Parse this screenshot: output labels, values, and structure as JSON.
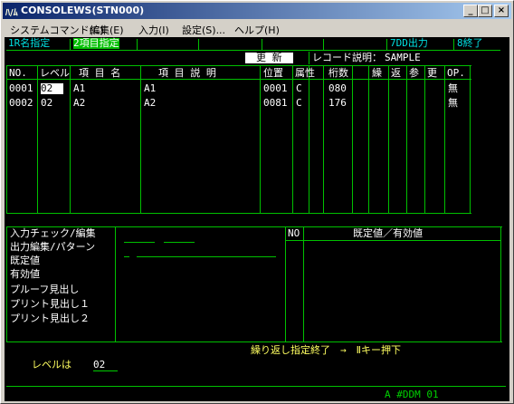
{
  "window": {
    "title": "CONSOLEWS(STN000)"
  },
  "menu": [
    "システムコマンド(C)",
    "編集(E)",
    "入力(I)",
    "設定(S)...",
    "ヘルプ(H)"
  ],
  "top": {
    "item1": "1R名指定",
    "item2": "2項目指定",
    "item7": "7DD出力",
    "item8": "8終了",
    "mode": "更 新",
    "record_label": "レコード説明：",
    "record_value": "SAMPLE"
  },
  "headers": [
    "NO.",
    "レベル",
    "項 目 名",
    "項 目 説 明",
    "位置",
    "属性",
    "桁数",
    "繰",
    "返",
    "参",
    "更",
    "OP."
  ],
  "rows": [
    {
      "no": "0001",
      "level": "02",
      "name": "A1",
      "desc": "A1",
      "pos": "0001",
      "attr": "C",
      "digits": "080",
      "op": "無"
    },
    {
      "no": "0002",
      "level": "02",
      "name": "A2",
      "desc": "A2",
      "pos": "0081",
      "attr": "C",
      "digits": "176",
      "op": "無"
    }
  ],
  "detail": {
    "labels": [
      "入力チェック/編集",
      "出力編集/パターン",
      "既定値",
      "有効値",
      "プルーフ見出し",
      "プリント見出し１",
      "プリント見出し２"
    ],
    "no_header": "NO",
    "default_header": "既定値／有効値"
  },
  "footer": {
    "message": "繰り返し指定終了　→　Ⅱキー押下",
    "level_label": "レベルは",
    "level_value": "02",
    "status": "A #DDM   01"
  }
}
